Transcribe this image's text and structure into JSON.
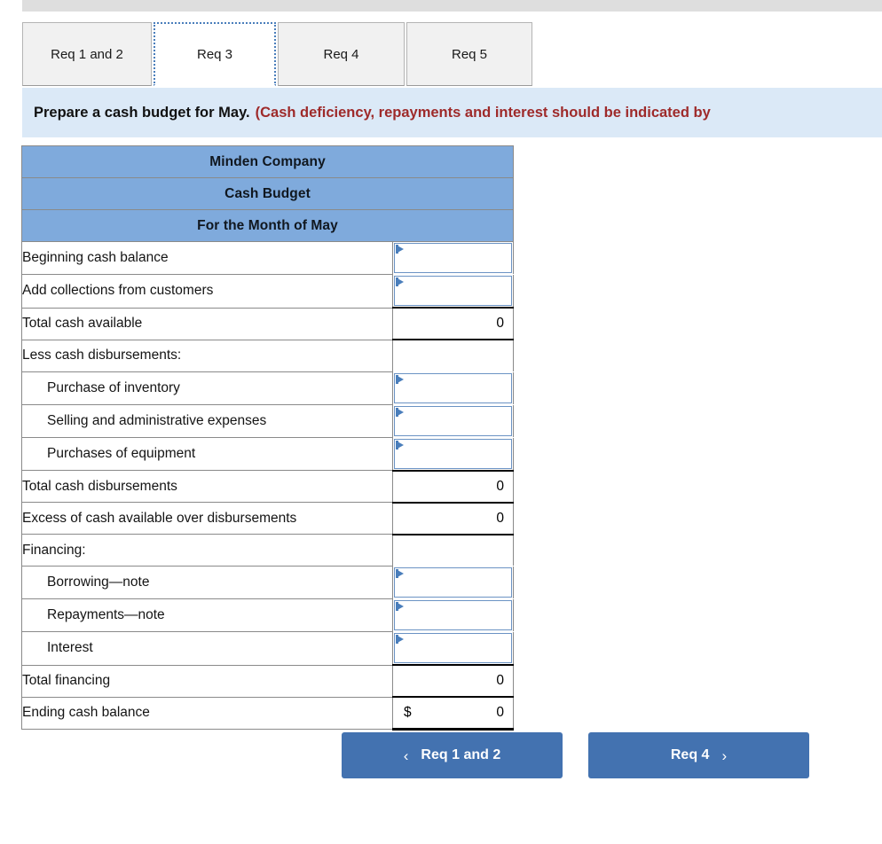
{
  "colors": {
    "header_blue": "#7faadc",
    "banner_blue": "#dbe9f7",
    "button_blue": "#4372b0",
    "note_red": "#9e2a2a",
    "input_border": "#6b93c4"
  },
  "tabs": [
    {
      "label": "Req 1 and 2",
      "active": false
    },
    {
      "label": "Req 3",
      "active": true
    },
    {
      "label": "Req 4",
      "active": false
    },
    {
      "label": "Req 5",
      "active": false
    }
  ],
  "banner": {
    "instruction": "Prepare a cash budget for May.",
    "note": "(Cash deficiency, repayments and interest should be indicated by"
  },
  "table": {
    "titles": [
      "Minden Company",
      "Cash Budget",
      "For the Month of May"
    ],
    "rows": [
      {
        "label": "Beginning cash balance",
        "indent": false,
        "kind": "input",
        "value": ""
      },
      {
        "label": "Add collections from customers",
        "indent": false,
        "kind": "input",
        "value": ""
      },
      {
        "label": "Total cash available",
        "indent": false,
        "kind": "total",
        "value": "0"
      },
      {
        "label": "Less cash disbursements:",
        "indent": false,
        "kind": "section",
        "value": ""
      },
      {
        "label": "Purchase of inventory",
        "indent": true,
        "kind": "input",
        "value": ""
      },
      {
        "label": "Selling and administrative expenses",
        "indent": true,
        "kind": "input",
        "value": ""
      },
      {
        "label": "Purchases of equipment",
        "indent": true,
        "kind": "input",
        "value": ""
      },
      {
        "label": "Total cash disbursements",
        "indent": false,
        "kind": "total",
        "value": "0"
      },
      {
        "label": "Excess of cash available over disbursements",
        "indent": false,
        "kind": "total",
        "value": "0"
      },
      {
        "label": "Financing:",
        "indent": false,
        "kind": "section",
        "value": ""
      },
      {
        "label": "Borrowing—note",
        "indent": true,
        "kind": "input",
        "value": ""
      },
      {
        "label": "Repayments—note",
        "indent": true,
        "kind": "input",
        "value": ""
      },
      {
        "label": "Interest",
        "indent": true,
        "kind": "input",
        "value": ""
      },
      {
        "label": "Total financing",
        "indent": false,
        "kind": "total",
        "value": "0"
      },
      {
        "label": "Ending cash balance",
        "indent": false,
        "kind": "grand",
        "currency": "$",
        "value": "0"
      }
    ]
  },
  "nav": {
    "prev_chevron": "‹",
    "prev_label": "Req 1 and 2",
    "next_label": "Req 4",
    "next_chevron": "›"
  }
}
